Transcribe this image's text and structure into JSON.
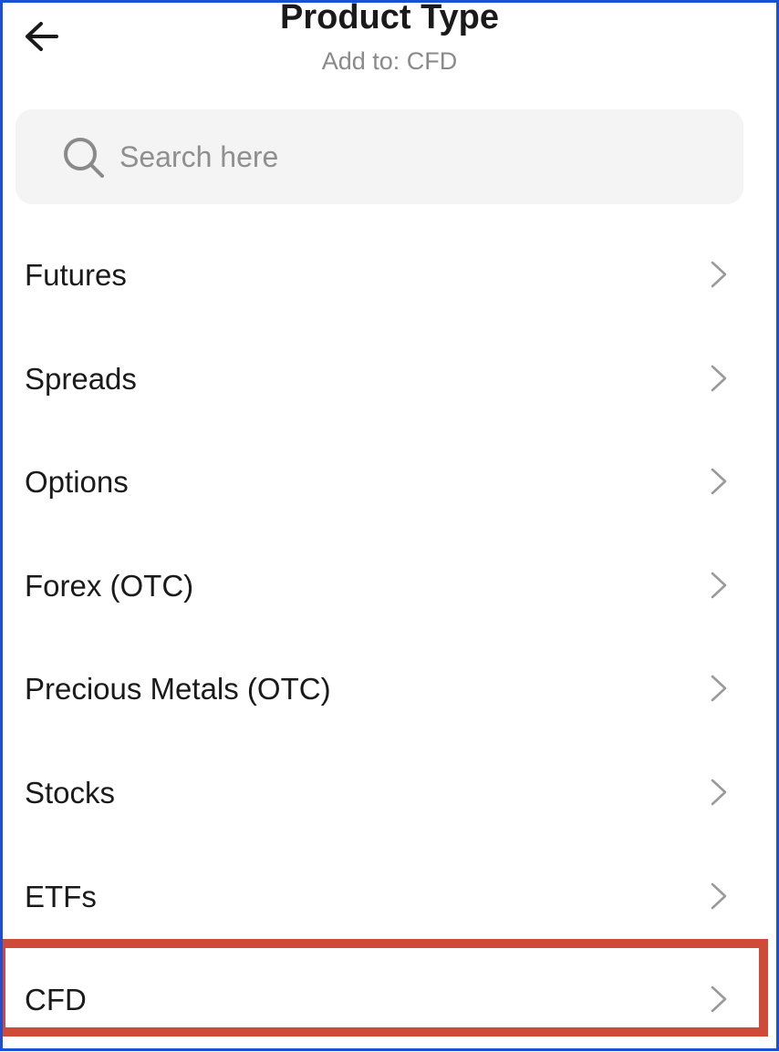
{
  "header": {
    "title": "Product Type",
    "subtitle": "Add to: CFD",
    "back_icon": "arrow-left-icon"
  },
  "search": {
    "placeholder": "Search here",
    "value": "",
    "icon": "search-icon"
  },
  "list": {
    "items": [
      {
        "label": "Futures",
        "icon": "chevron-right-icon"
      },
      {
        "label": "Spreads",
        "icon": "chevron-right-icon"
      },
      {
        "label": "Options",
        "icon": "chevron-right-icon"
      },
      {
        "label": "Forex (OTC)",
        "icon": "chevron-right-icon"
      },
      {
        "label": "Precious Metals (OTC)",
        "icon": "chevron-right-icon"
      },
      {
        "label": "Stocks",
        "icon": "chevron-right-icon"
      },
      {
        "label": "ETFs",
        "icon": "chevron-right-icon"
      },
      {
        "label": "CFD",
        "icon": "chevron-right-icon",
        "highlighted": true
      }
    ]
  },
  "colors": {
    "frame_border": "#1a4fd6",
    "highlight_border": "#d04a3a",
    "search_background": "#f4f4f4",
    "chevron": "#9a9a9a",
    "subtitle_text": "#8a8a8a"
  }
}
